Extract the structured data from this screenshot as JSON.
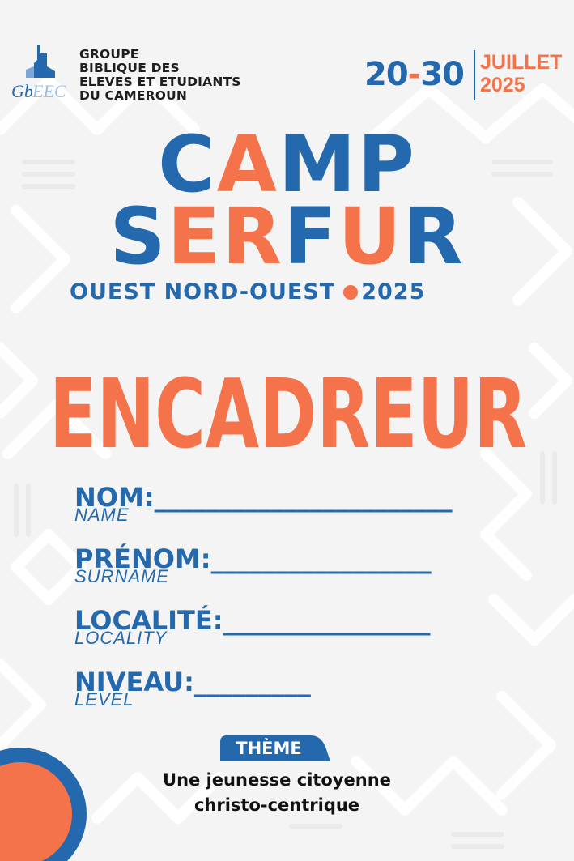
{
  "header": {
    "org_lines": [
      "GROUPE",
      "BIBLIQUE DES",
      "ELEVES ET ETUDIANTS",
      "DU CAMEROUN"
    ],
    "logo_text": "GbEEC",
    "date_start": "20",
    "date_sep": "-",
    "date_end": "30",
    "month": "JUILLET",
    "year": "2025"
  },
  "title": {
    "line1": [
      "C",
      "A",
      "MP"
    ],
    "line2": [
      "S",
      "ER",
      "F",
      "U",
      "R"
    ]
  },
  "region": {
    "name": "OUEST NORD-OUEST",
    "year": "2025"
  },
  "role": "ENCADREUR",
  "fields": [
    {
      "label": "NOM:",
      "blank": "_______________________",
      "sub": "NAME"
    },
    {
      "label": "PRÉNOM:",
      "blank": "_________________",
      "sub": "SURNAME"
    },
    {
      "label": "LOCALITÉ:",
      "blank": "________________",
      "sub": "LOCALITY"
    },
    {
      "label": "NIVEAU:",
      "blank": "_________",
      "sub": "LEVEL"
    }
  ],
  "theme": {
    "label": "THÈME",
    "line1": "Une jeunesse citoyenne",
    "line2": "christo-centrique"
  },
  "colors": {
    "blue": "#2469ad",
    "orange": "#f5734a",
    "background": "#f4f4f4"
  }
}
